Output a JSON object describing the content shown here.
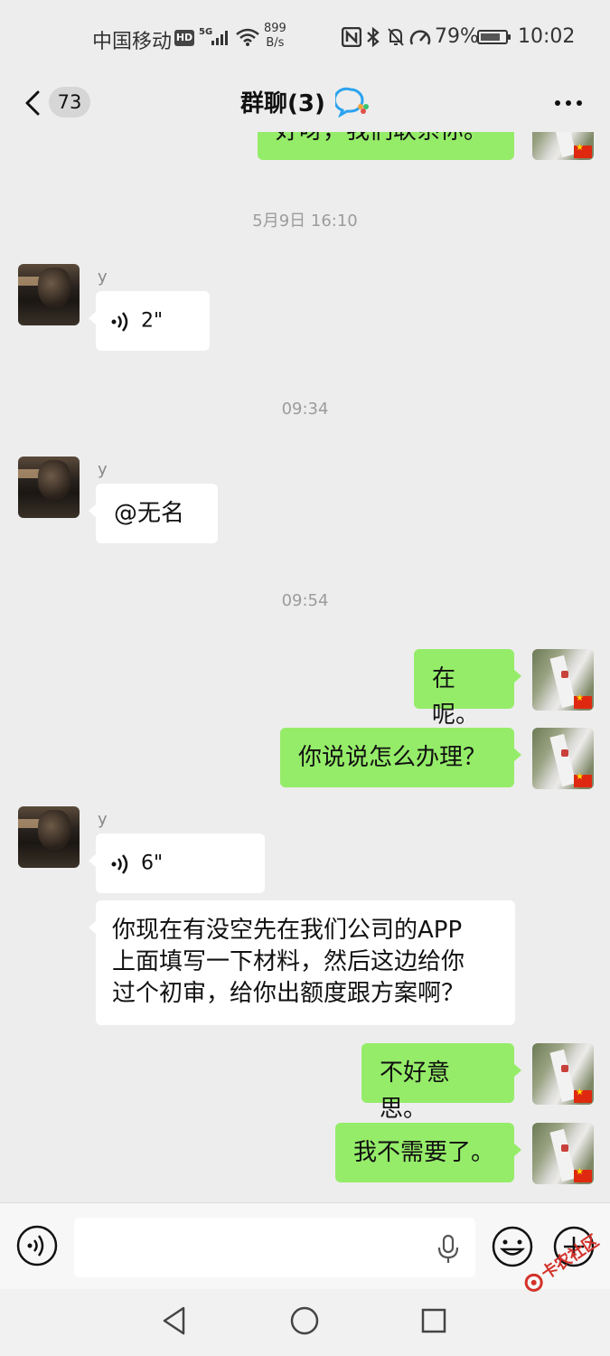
{
  "status_bar": {
    "carrier": "中国移动",
    "hd": "HD",
    "network": "5G",
    "speed_value": "899",
    "speed_unit": "B/s",
    "battery": "79%",
    "battery_level": 0.79,
    "time": "10:02"
  },
  "header": {
    "unread_count": "73",
    "title": "群聊(3)",
    "icons": [
      "back-icon",
      "group-chat-badge-icon",
      "more-icon"
    ]
  },
  "messages": [
    {
      "type": "partial",
      "side": "out",
      "text": "好呀，我们联系你。"
    },
    {
      "type": "timestamp",
      "text": "5月9日 16:10"
    },
    {
      "type": "voice",
      "side": "in",
      "sender": "y",
      "duration": "2\""
    },
    {
      "type": "timestamp",
      "text": "09:34"
    },
    {
      "type": "text",
      "side": "in",
      "sender": "y",
      "text": "@无名"
    },
    {
      "type": "timestamp",
      "text": "09:54"
    },
    {
      "type": "text",
      "side": "out",
      "text": "在呢。"
    },
    {
      "type": "text",
      "side": "out",
      "text": "你说说怎么办理？"
    },
    {
      "type": "voice",
      "side": "in",
      "sender": "y",
      "duration": "6\""
    },
    {
      "type": "text",
      "side": "in",
      "lines": [
        "你现在有没空先在我们公司的APP",
        "上面填写一下材料，然后这边给你",
        "过个初审，给你出额度跟方案啊？"
      ]
    },
    {
      "type": "text",
      "side": "out",
      "text": "不好意思。"
    },
    {
      "type": "text",
      "side": "out",
      "text": "我不需要了。"
    }
  ],
  "input_bar": {
    "placeholder": "",
    "icons": [
      "voice-toggle-icon",
      "mic-icon",
      "emoji-icon",
      "plus-icon"
    ]
  },
  "watermark": "卡农社区",
  "colors": {
    "background": "#ededed",
    "bubble_out": "#95ec69",
    "bubble_in": "#ffffff",
    "timestamp": "#9c9c9c"
  }
}
